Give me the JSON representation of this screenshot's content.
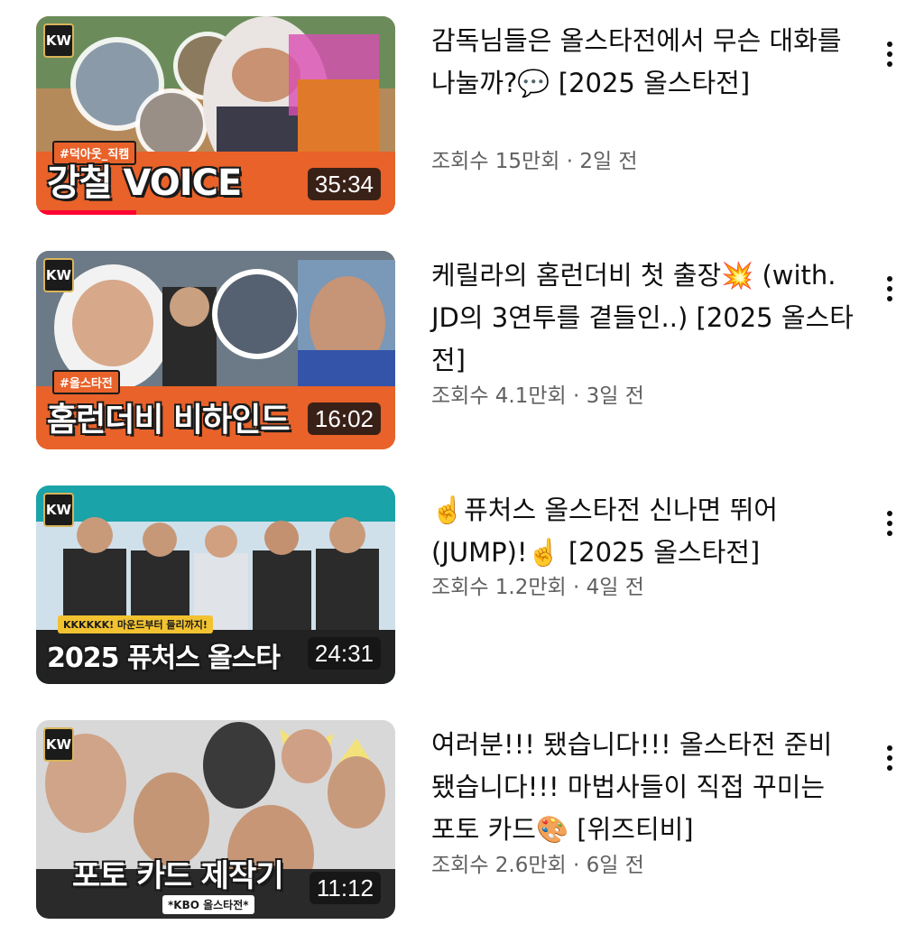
{
  "videos": [
    {
      "title": "감독님들은 올스타전에서 무슨 대화를 나눌까?💬 [2025 올스타전]",
      "views": "조회수 15만회",
      "sep": "·",
      "age": "2일 전",
      "duration": "35:34",
      "progress": 0.28,
      "thumb": {
        "tag": "#덕아웃_직캠",
        "overlay": "강철 VOICE",
        "accent": "#e8622a",
        "logo": "KW"
      }
    },
    {
      "title": "케릴라의 홈런더비 첫 출장💥 (with. JD의 3연투를 곁들인..) [2025 올스타전]",
      "views": "조회수 4.1만회",
      "sep": "·",
      "age": "3일 전",
      "duration": "16:02",
      "progress": 0,
      "thumb": {
        "tag": "#올스타전",
        "overlay": "홈런더비 비하인드",
        "accent": "#e8622a",
        "logo": "KW"
      }
    },
    {
      "title": "☝️퓨처스 올스타전 신나면 뛰어(JUMP)!☝️ [2025 올스타전]",
      "views": "조회수 1.2만회",
      "sep": "·",
      "age": "4일 전",
      "duration": "24:31",
      "progress": 0,
      "thumb": {
        "tag": "KKKKKK! 마운드부터 들리까지!",
        "overlay": "2025 퓨처스 올스타",
        "accent": "#1aa3a8",
        "logo": "KW"
      }
    },
    {
      "title": "여러분!!! 됐습니다!!! 올스타전 준비됐습니다!!! 마법사들이 직접 꾸미는 포토 카드🎨 [위즈티비]",
      "views": "조회수 2.6만회",
      "sep": "·",
      "age": "6일 전",
      "duration": "11:12",
      "progress": 0,
      "thumb": {
        "tag": "*KBO 올스타전*",
        "overlay": "포토 카드 제작기",
        "accent": "#2a2a2a",
        "logo": "KW"
      }
    }
  ],
  "icons": {
    "more": "more-vert-icon"
  }
}
